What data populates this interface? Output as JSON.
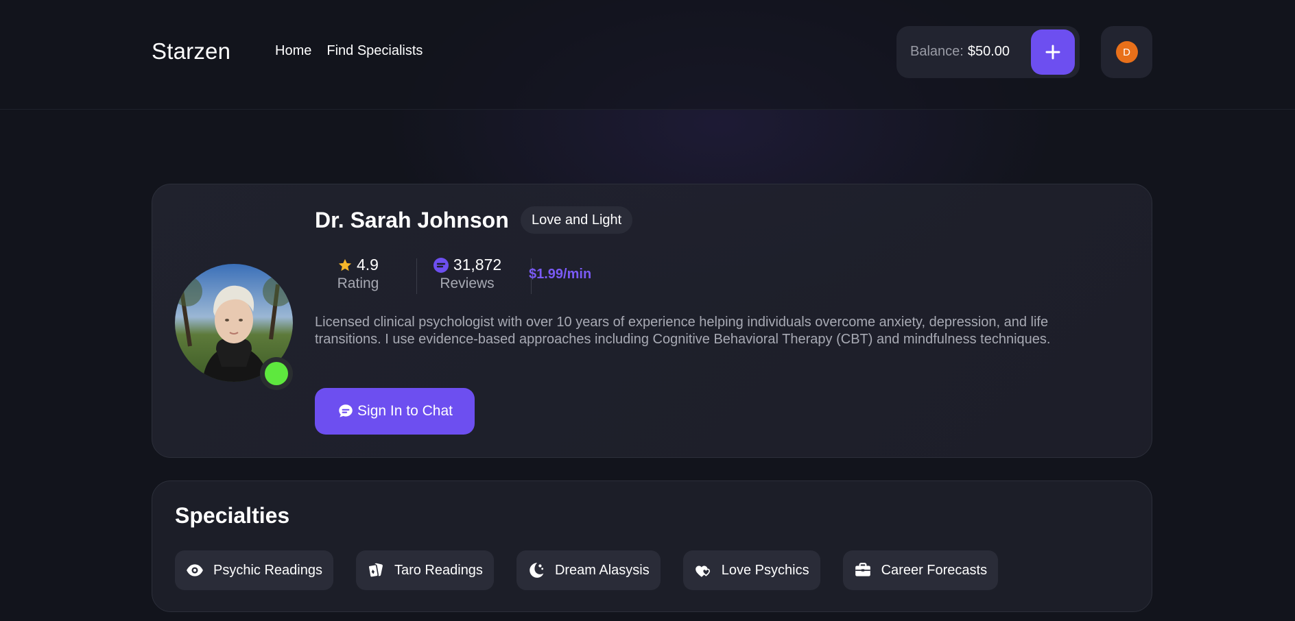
{
  "header": {
    "logo": "Starzen",
    "nav": [
      "Home",
      "Find Specialists"
    ],
    "balance_label": "Balance:",
    "balance_value": "$50.00",
    "add_icon": "plus-icon",
    "avatar_initial": "D",
    "avatar_color": "#e8701a"
  },
  "profile": {
    "name": "Dr. Sarah Johnson",
    "title": "Love and Light",
    "rating": "4.9",
    "rating_label": "Rating",
    "reviews": "31,872",
    "reviews_label": "Reviews",
    "price": "$1.99/min",
    "bio": "Licensed clinical psychologist with over 10 years of experience helping individuals overcome anxiety, depression, and life transitions. I use evidence-based approaches including Cognitive Behavioral Therapy (CBT) and mindfulness techniques.",
    "chat_button": "Sign In to Chat",
    "online_color": "#5ee83e"
  },
  "specialties": {
    "title": "Specialties",
    "items": [
      {
        "label": "Psychic Readings",
        "icon": "eye-icon"
      },
      {
        "label": "Taro Readings",
        "icon": "cards-icon"
      },
      {
        "label": "Dream Alasysis",
        "icon": "moon-icon"
      },
      {
        "label": "Love Psychics",
        "icon": "hearts-icon"
      },
      {
        "label": "Career Forecasts",
        "icon": "briefcase-icon"
      }
    ]
  },
  "colors": {
    "accent": "#6d4ff0",
    "price": "#7a5af5",
    "star": "#f5b72a"
  }
}
